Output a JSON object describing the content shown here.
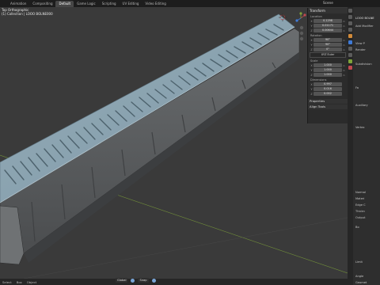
{
  "workspace_tabs": [
    "Animation",
    "Compositing",
    "Default",
    "Game Logic",
    "Scripting",
    "UV Editing",
    "Video Editing"
  ],
  "active_tab": "Default",
  "scene": "Scene",
  "viewport": {
    "mode": "Top Orthographic",
    "collection": "(1) Collection | LOOO BOLNE000"
  },
  "transform": {
    "header": "Transform",
    "location_label": "Location",
    "location": [
      {
        "axis": "X",
        "value": "0.1298"
      },
      {
        "axis": "Y",
        "value": "0.01171"
      },
      {
        "axis": "Z",
        "value": "0.00644"
      }
    ],
    "rotation_label": "Rotation",
    "rotation": [
      {
        "axis": "X",
        "value": "90°"
      },
      {
        "axis": "Y",
        "value": "90°"
      },
      {
        "axis": "Z",
        "value": "0°"
      }
    ],
    "mode": "XYZ Euler",
    "scale_label": "Scale",
    "scale": [
      {
        "axis": "X",
        "value": "1.000"
      },
      {
        "axis": "Y",
        "value": "1.000"
      },
      {
        "axis": "Z",
        "value": "1.000"
      }
    ],
    "dimensions_label": "Dimensions",
    "dimensions": [
      {
        "axis": "X",
        "value": "0.997"
      },
      {
        "axis": "Y",
        "value": "0.016"
      },
      {
        "axis": "Z",
        "value": "0.002"
      }
    ],
    "properties": "Properties",
    "align_tools": "Align Tools"
  },
  "properties_panel": {
    "object_name": "LOOO BOLNE",
    "add_modifier": "Add Modifier",
    "rows": [
      "View P",
      "Render",
      "Subdivision",
      "Fa",
      "Auxiliary",
      "Vertex",
      "Normal",
      "Materi",
      "Edge C",
      "Thickn",
      "Output",
      "Bo",
      "Limit",
      "Angle",
      "Geomet"
    ]
  },
  "statusbar": {
    "items": [
      "Select",
      "Box",
      "Object"
    ]
  },
  "toolbar": {
    "orientation": "Global",
    "snap": "Snap"
  },
  "colors": {
    "grate": "#87a0ad",
    "body": "#5b5e60",
    "active_tab": "#474747",
    "axis_x": "#c0494f",
    "axis_y": "#7ea33a",
    "axis_z": "#3f7ad6"
  }
}
